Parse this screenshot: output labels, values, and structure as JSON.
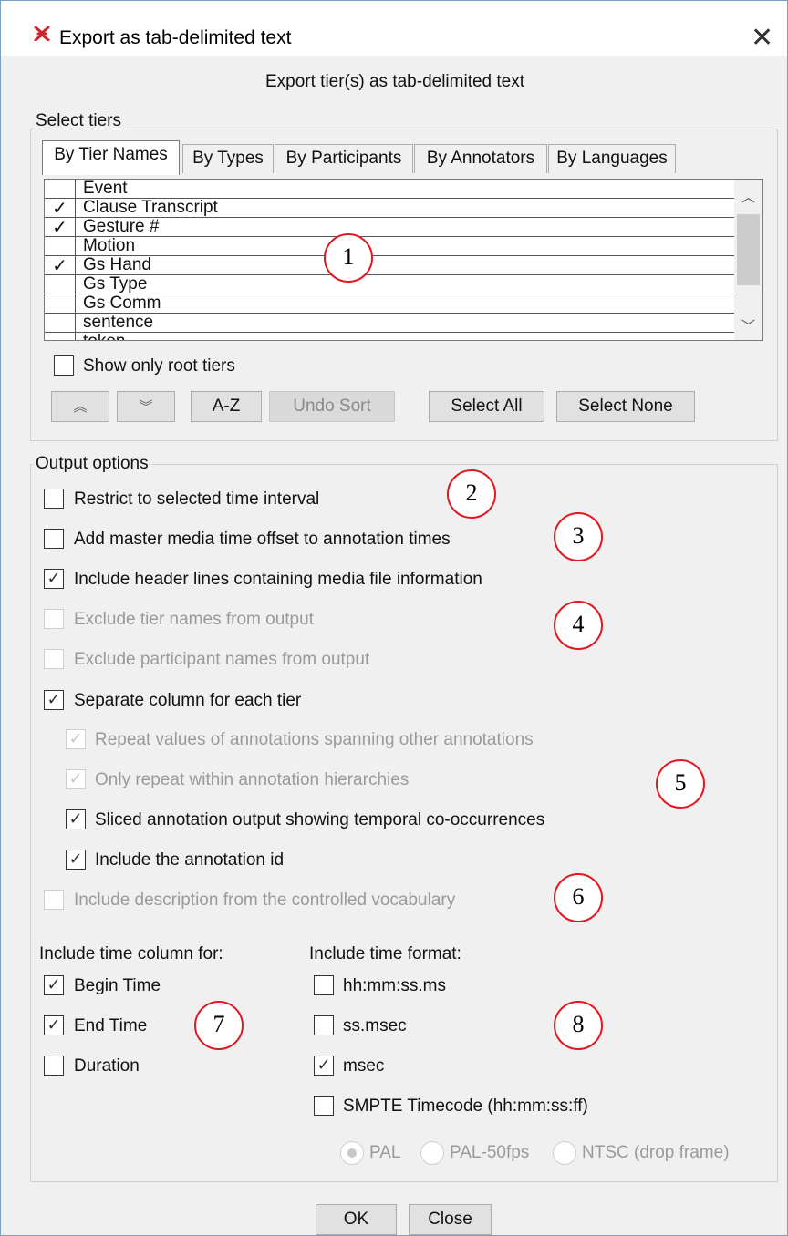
{
  "window": {
    "title": "Export as tab-delimited text",
    "close_glyph": "✕"
  },
  "dialog": {
    "subtitle": "Export tier(s) as tab-delimited text"
  },
  "select_tiers": {
    "legend": "Select tiers",
    "tabs": [
      "By Tier Names",
      "By Types",
      "By Participants",
      "By Annotators",
      "By Languages"
    ],
    "tiers": [
      {
        "name": "Event",
        "checked": false
      },
      {
        "name": "Clause Transcript",
        "checked": true
      },
      {
        "name": "Gesture #",
        "checked": true
      },
      {
        "name": "Motion",
        "checked": false
      },
      {
        "name": "Gs Hand",
        "checked": true
      },
      {
        "name": "Gs Type",
        "checked": false
      },
      {
        "name": "Gs Comm",
        "checked": false
      },
      {
        "name": "sentence",
        "checked": false
      },
      {
        "name": "token",
        "checked": false
      }
    ],
    "show_only_root": {
      "label": "Show only root tiers",
      "checked": false
    },
    "buttons": {
      "move_up": "︽",
      "move_down": "︾",
      "az": "A-Z",
      "undo_sort": "Undo Sort",
      "select_all": "Select All",
      "select_none": "Select None"
    }
  },
  "output_options": {
    "legend": "Output options",
    "restrict": {
      "label": "Restrict to selected time interval",
      "checked": false
    },
    "add_offset": {
      "label": "Add master media time offset to annotation times",
      "checked": false
    },
    "header_lines": {
      "label": "Include header lines containing media file information",
      "checked": true
    },
    "exclude_tier_names": {
      "label": "Exclude tier names from output",
      "checked": false,
      "disabled": true
    },
    "exclude_participants": {
      "label": "Exclude participant names from output",
      "checked": false,
      "disabled": true
    },
    "separate_column": {
      "label": "Separate column for each tier",
      "checked": true
    },
    "repeat_values": {
      "label": "Repeat values of annotations spanning other annotations",
      "checked": true,
      "disabled": true
    },
    "only_repeat": {
      "label": "Only repeat within annotation hierarchies",
      "checked": true,
      "disabled": true
    },
    "sliced": {
      "label": "Sliced annotation output showing temporal co-occurrences",
      "checked": true
    },
    "annotation_id": {
      "label": "Include the annotation id",
      "checked": true
    },
    "cv_description": {
      "label": "Include description from the controlled vocabulary",
      "checked": false,
      "disabled": true
    },
    "time_column": {
      "heading": "Include time column for:",
      "begin": {
        "label": "Begin Time",
        "checked": true
      },
      "end": {
        "label": "End Time",
        "checked": true
      },
      "duration": {
        "label": "Duration",
        "checked": false
      }
    },
    "time_format": {
      "heading": "Include time format:",
      "hhmmss": {
        "label": "hh:mm:ss.ms",
        "checked": false
      },
      "ssmsec": {
        "label": "ss.msec",
        "checked": false
      },
      "msec": {
        "label": "msec",
        "checked": true
      },
      "smpte": {
        "label": "SMPTE Timecode (hh:mm:ss:ff)",
        "checked": false
      },
      "radios": [
        "PAL",
        "PAL-50fps",
        "NTSC (drop frame)"
      ],
      "selected_radio": "PAL"
    }
  },
  "footer": {
    "ok": "OK",
    "close": "Close"
  },
  "callouts": [
    "1",
    "2",
    "3",
    "4",
    "5",
    "6",
    "7",
    "8"
  ],
  "colors": {
    "callout_ring": "#e4161f",
    "app_icon": "#d0252b"
  },
  "icons": {
    "app": "elan-app-icon",
    "close": "close-icon",
    "check": "check-icon"
  }
}
